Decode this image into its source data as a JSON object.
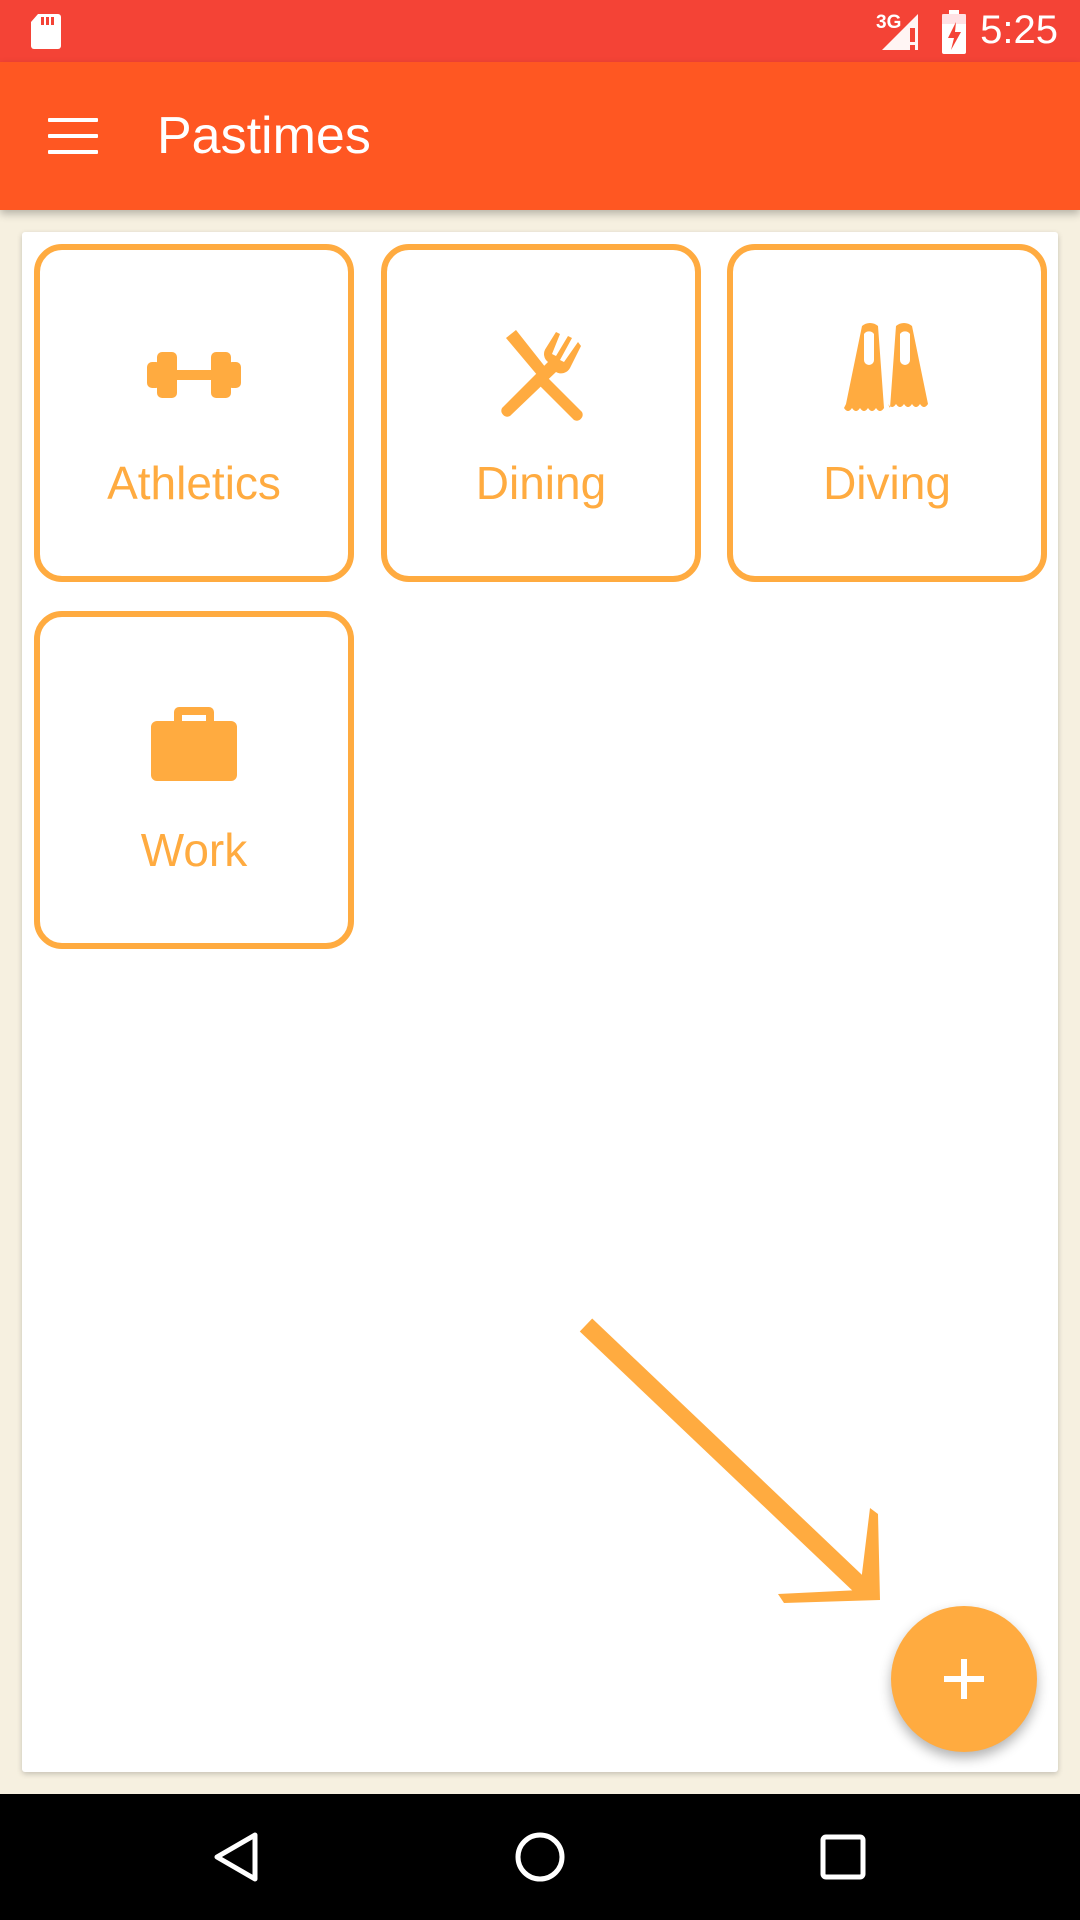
{
  "status_bar": {
    "network": "3G",
    "time": "5:25"
  },
  "app_bar": {
    "title": "Pastimes",
    "menu_icon": "hamburger-menu-icon"
  },
  "pastimes": [
    {
      "label": "Athletics",
      "icon": "dumbbell-icon"
    },
    {
      "label": "Dining",
      "icon": "fork-knife-icon"
    },
    {
      "label": "Diving",
      "icon": "flippers-icon"
    },
    {
      "label": "Work",
      "icon": "briefcase-icon"
    }
  ],
  "fab": {
    "icon": "plus-icon"
  },
  "colors": {
    "status_bar": "#f44336",
    "app_bar": "#ff5722",
    "accent": "#ffab40"
  },
  "nav_bar": {
    "icons": [
      "back-icon",
      "home-icon",
      "recents-icon"
    ]
  }
}
